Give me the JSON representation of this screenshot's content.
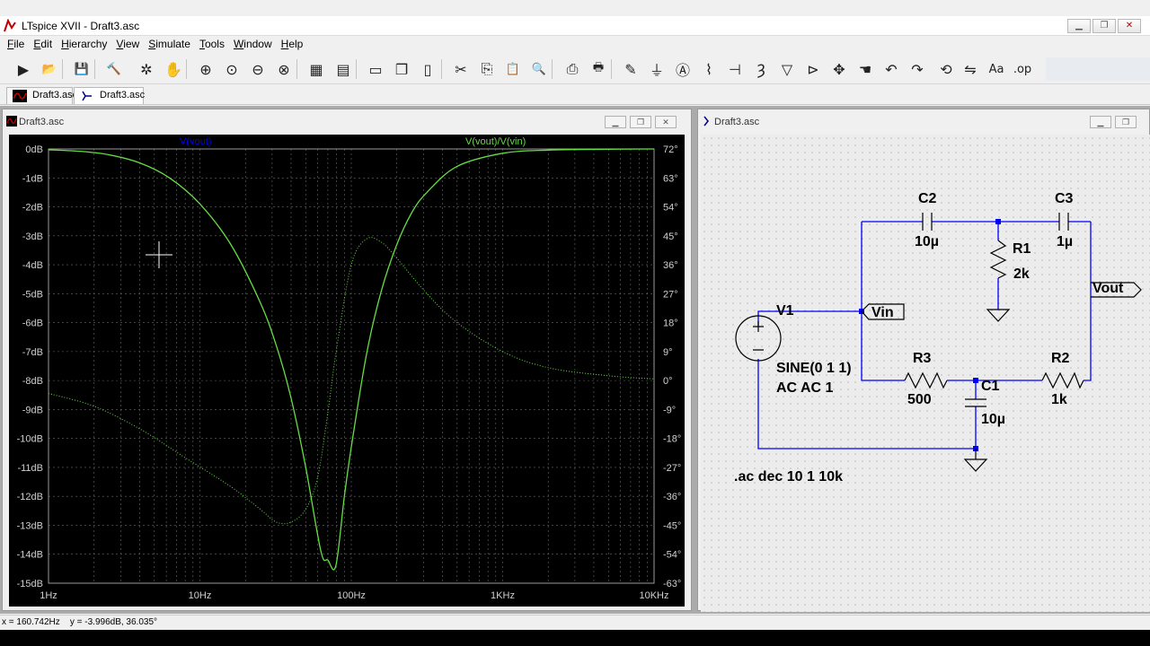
{
  "app": {
    "title": "LTspice XVII - Draft3.asc"
  },
  "menu": [
    {
      "label": "File",
      "key": "F",
      "rest": "ile"
    },
    {
      "label": "Edit",
      "key": "E",
      "rest": "dit"
    },
    {
      "label": "Hierarchy",
      "key": "H",
      "rest": "ierarchy"
    },
    {
      "label": "View",
      "key": "V",
      "rest": "iew"
    },
    {
      "label": "Simulate",
      "key": "S",
      "rest": "imulate"
    },
    {
      "label": "Tools",
      "key": "T",
      "rest": "ools"
    },
    {
      "label": "Window",
      "key": "W",
      "rest": "indow"
    },
    {
      "label": "Help",
      "key": "H",
      "rest": "elp"
    }
  ],
  "toolbar": {
    "buttons": [
      {
        "name": "run-icon",
        "glyph": "▶"
      },
      {
        "name": "open-icon",
        "glyph": "📂"
      },
      {
        "name": "save-icon",
        "glyph": "💾"
      },
      {
        "name": "control-panel-icon",
        "glyph": "🔨"
      },
      {
        "name": "halt-icon",
        "glyph": "✲"
      },
      {
        "name": "pan-icon",
        "glyph": "✋"
      },
      {
        "name": "zoom-in-icon",
        "glyph": "⊕"
      },
      {
        "name": "zoom-full-icon",
        "glyph": "⊙"
      },
      {
        "name": "zoom-out-icon",
        "glyph": "⊖"
      },
      {
        "name": "zoom-cancel-icon",
        "glyph": "⊗"
      },
      {
        "name": "autorange-icon",
        "glyph": "▦"
      },
      {
        "name": "grid-icon",
        "glyph": "▤"
      },
      {
        "name": "tile-horizontal-icon",
        "glyph": "▭"
      },
      {
        "name": "cascade-icon",
        "glyph": "❐"
      },
      {
        "name": "tile-vertical-icon",
        "glyph": "▯"
      },
      {
        "name": "cut-icon",
        "glyph": "✂"
      },
      {
        "name": "copy-icon",
        "glyph": "⎘"
      },
      {
        "name": "paste-icon",
        "glyph": "📋"
      },
      {
        "name": "find-icon",
        "glyph": "🔍"
      },
      {
        "name": "print-preview-icon",
        "glyph": "⎙"
      },
      {
        "name": "print-icon",
        "glyph": "🖶"
      },
      {
        "name": "draw-wire-icon",
        "glyph": "✎"
      },
      {
        "name": "ground-icon",
        "glyph": "⏚"
      },
      {
        "name": "label-net-icon",
        "glyph": "Ⓐ"
      },
      {
        "name": "resistor-icon",
        "glyph": "⌇"
      },
      {
        "name": "capacitor-icon",
        "glyph": "⊣"
      },
      {
        "name": "inductor-icon",
        "glyph": "Ȝ"
      },
      {
        "name": "diode-icon",
        "glyph": "▽"
      },
      {
        "name": "component-icon",
        "glyph": "⊳"
      },
      {
        "name": "move-icon",
        "glyph": "✥"
      },
      {
        "name": "drag-icon",
        "glyph": "☚"
      },
      {
        "name": "undo-icon",
        "glyph": "↶"
      },
      {
        "name": "redo-icon",
        "glyph": "↷"
      },
      {
        "name": "rotate-icon",
        "glyph": "⟲"
      },
      {
        "name": "mirror-icon",
        "glyph": "⇋"
      },
      {
        "name": "text-icon",
        "glyph": "Aa"
      },
      {
        "name": "spice-directive-icon",
        "glyph": ".op"
      }
    ]
  },
  "tabs": [
    {
      "label": "Draft3.asc",
      "kind": "plot"
    },
    {
      "label": "Draft3.asc",
      "kind": "schematic"
    }
  ],
  "plot_window": {
    "title": "Draft3.asc",
    "trace_labels": [
      {
        "label": "V(vout)",
        "color": "#0000ff"
      },
      {
        "label": "V(vout)/V(vin)",
        "color": "#66dd44"
      }
    ]
  },
  "chart_data": {
    "type": "line",
    "x_scale": "log",
    "xlim": [
      1,
      10000
    ],
    "x_ticks": [
      "1Hz",
      "10Hz",
      "100Hz",
      "1KHz",
      "10KHz"
    ],
    "y_left_ticks": [
      "0dB",
      "-1dB",
      "-2dB",
      "-3dB",
      "-4dB",
      "-5dB",
      "-6dB",
      "-7dB",
      "-8dB",
      "-9dB",
      "-10dB",
      "-11dB",
      "-12dB",
      "-13dB",
      "-14dB",
      "-15dB"
    ],
    "ylim_left": [
      -15,
      0
    ],
    "y_right_ticks": [
      "72°",
      "63°",
      "54°",
      "45°",
      "36°",
      "27°",
      "18°",
      "9°",
      "0°",
      "-9°",
      "-18°",
      "-27°",
      "-36°",
      "-45°",
      "-54°",
      "-63°"
    ],
    "ylim_right": [
      -63,
      72
    ],
    "grid": true,
    "series": [
      {
        "name": "V(vout)/V(vin)",
        "axis": "magnitude",
        "line": "solid",
        "color": "#66dd44",
        "x": [
          1,
          1.6,
          2.5,
          4,
          6.3,
          10,
          16,
          25,
          32,
          40,
          50,
          63,
          70,
          79,
          90,
          100,
          126,
          158,
          200,
          251,
          316,
          500,
          1000,
          2000,
          5000,
          10000
        ],
        "y": [
          -0.03,
          -0.08,
          -0.2,
          -0.48,
          -1.0,
          -1.9,
          -3.3,
          -5.3,
          -6.8,
          -8.6,
          -11.0,
          -13.9,
          -14.2,
          -14.4,
          -12.0,
          -10.3,
          -7.1,
          -4.9,
          -3.3,
          -2.2,
          -1.5,
          -0.6,
          -0.15,
          -0.04,
          -0.01,
          0.0
        ]
      },
      {
        "name": "V(vout)/V(vin)",
        "axis": "phase",
        "line": "dotted",
        "color": "#66dd44",
        "x": [
          1,
          2,
          4,
          8,
          16,
          25,
          32,
          40,
          50,
          60,
          70,
          80,
          100,
          126,
          158,
          200,
          316,
          500,
          1000,
          2000,
          5000,
          10000
        ],
        "y": [
          -4,
          -8,
          -15,
          -24,
          -33,
          -40,
          -44,
          -44,
          -40,
          -30,
          -10,
          10,
          36,
          44,
          43,
          38,
          27,
          18,
          9,
          4,
          1.5,
          0.5
        ]
      }
    ]
  },
  "schematic_window": {
    "title": "Draft3.asc",
    "components": {
      "c2": {
        "name": "C2",
        "value": "10µ"
      },
      "c3": {
        "name": "C3",
        "value": "1µ"
      },
      "r1": {
        "name": "R1",
        "value": "2k"
      },
      "r3": {
        "name": "R3",
        "value": "500"
      },
      "r2": {
        "name": "R2",
        "value": "1k"
      },
      "c1": {
        "name": "C1",
        "value": "10µ"
      },
      "v1": {
        "name": "V1",
        "value1": "SINE(0 1 1)",
        "value2": "AC AC 1"
      }
    },
    "labels": {
      "vin": "Vin",
      "vout": "Vout"
    },
    "directive": ".ac dec 10 1 10k",
    "colors": {
      "wire": "#0000ff",
      "symbol": "#000000"
    }
  },
  "status": {
    "text": "x = 160.742Hz    y = -3.996dB, 36.035°"
  }
}
